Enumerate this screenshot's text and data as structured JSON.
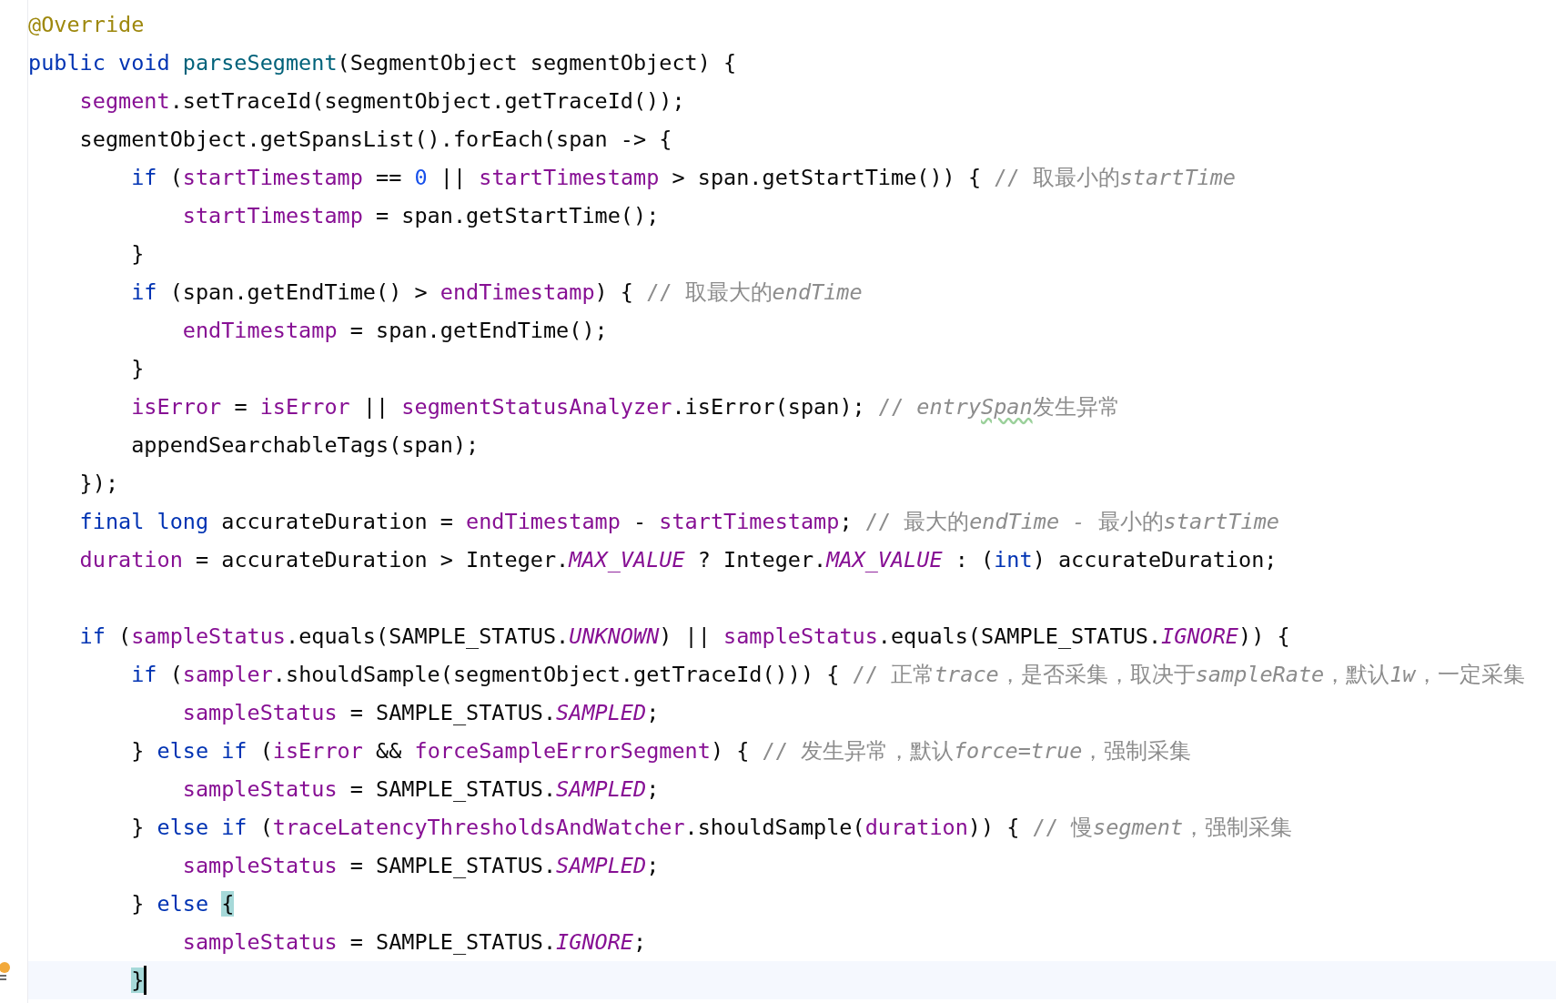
{
  "editor": {
    "lines": [
      {
        "kind": "code",
        "current": false,
        "tokens": [
          {
            "kind": "annotation",
            "text": "@Override"
          }
        ]
      },
      {
        "kind": "code",
        "current": false,
        "tokens": [
          {
            "kind": "keyword",
            "text": "public void "
          },
          {
            "kind": "method_decl",
            "text": "parseSegment"
          },
          {
            "kind": "plain",
            "text": "(SegmentObject segmentObject) {"
          }
        ]
      },
      {
        "kind": "code",
        "current": false,
        "tokens": [
          {
            "kind": "field",
            "text": "    segment"
          },
          {
            "kind": "plain",
            "text": ".setTraceId(segmentObject.getTraceId());"
          }
        ]
      },
      {
        "kind": "code",
        "current": false,
        "tokens": [
          {
            "kind": "plain",
            "text": "    segmentObject.getSpansList().forEach(span -> {"
          }
        ]
      },
      {
        "kind": "code",
        "current": false,
        "tokens": [
          {
            "kind": "keyword",
            "text": "        if "
          },
          {
            "kind": "plain",
            "text": "("
          },
          {
            "kind": "field",
            "text": "startTimestamp"
          },
          {
            "kind": "plain",
            "text": " == "
          },
          {
            "kind": "number",
            "text": "0"
          },
          {
            "kind": "plain",
            "text": " || "
          },
          {
            "kind": "field",
            "text": "startTimestamp"
          },
          {
            "kind": "plain",
            "text": " > span.getStartTime()) { "
          },
          {
            "kind": "comment",
            "text": "// 取最小的"
          },
          {
            "kind": "comment_italic",
            "text": "startTime"
          }
        ]
      },
      {
        "kind": "code",
        "current": false,
        "tokens": [
          {
            "kind": "field",
            "text": "            startTimestamp"
          },
          {
            "kind": "plain",
            "text": " = span.getStartTime();"
          }
        ]
      },
      {
        "kind": "code",
        "current": false,
        "tokens": [
          {
            "kind": "plain",
            "text": "        }"
          }
        ]
      },
      {
        "kind": "code",
        "current": false,
        "tokens": [
          {
            "kind": "keyword",
            "text": "        if "
          },
          {
            "kind": "plain",
            "text": "(span.getEndTime() > "
          },
          {
            "kind": "field",
            "text": "endTimestamp"
          },
          {
            "kind": "plain",
            "text": ") { "
          },
          {
            "kind": "comment",
            "text": "// 取最大的"
          },
          {
            "kind": "comment_italic",
            "text": "endTime"
          }
        ]
      },
      {
        "kind": "code",
        "current": false,
        "tokens": [
          {
            "kind": "field",
            "text": "            endTimestamp"
          },
          {
            "kind": "plain",
            "text": " = span.getEndTime();"
          }
        ]
      },
      {
        "kind": "code",
        "current": false,
        "tokens": [
          {
            "kind": "plain",
            "text": "        }"
          }
        ]
      },
      {
        "kind": "code",
        "current": false,
        "tokens": [
          {
            "kind": "field",
            "text": "        isError"
          },
          {
            "kind": "plain",
            "text": " = "
          },
          {
            "kind": "field",
            "text": "isError"
          },
          {
            "kind": "plain",
            "text": " || "
          },
          {
            "kind": "field",
            "text": "segmentStatusAnalyzer"
          },
          {
            "kind": "plain",
            "text": ".isError(span); "
          },
          {
            "kind": "comment",
            "text": "// "
          },
          {
            "kind": "comment_italic",
            "text": "entry"
          },
          {
            "kind": "typo",
            "text": "Span"
          },
          {
            "kind": "comment",
            "text": "发生异常"
          }
        ]
      },
      {
        "kind": "code",
        "current": false,
        "tokens": [
          {
            "kind": "plain",
            "text": "        appendSearchableTags(span);"
          }
        ]
      },
      {
        "kind": "code",
        "current": false,
        "tokens": [
          {
            "kind": "plain",
            "text": "    });"
          }
        ]
      },
      {
        "kind": "code",
        "current": false,
        "tokens": [
          {
            "kind": "keyword",
            "text": "    final long "
          },
          {
            "kind": "plain",
            "text": "accurateDuration = "
          },
          {
            "kind": "field",
            "text": "endTimestamp"
          },
          {
            "kind": "plain",
            "text": " - "
          },
          {
            "kind": "field",
            "text": "startTimestamp"
          },
          {
            "kind": "plain",
            "text": "; "
          },
          {
            "kind": "comment",
            "text": "// 最大的"
          },
          {
            "kind": "comment_italic",
            "text": "endTime - "
          },
          {
            "kind": "comment",
            "text": "最小的"
          },
          {
            "kind": "comment_italic",
            "text": "startTime"
          }
        ]
      },
      {
        "kind": "code",
        "current": false,
        "tokens": [
          {
            "kind": "field",
            "text": "    duration"
          },
          {
            "kind": "plain",
            "text": " = accurateDuration > Integer."
          },
          {
            "kind": "constant",
            "text": "MAX_VALUE"
          },
          {
            "kind": "plain",
            "text": " ? Integer."
          },
          {
            "kind": "constant",
            "text": "MAX_VALUE"
          },
          {
            "kind": "plain",
            "text": " : ("
          },
          {
            "kind": "keyword",
            "text": "int"
          },
          {
            "kind": "plain",
            "text": ") accurateDuration;"
          }
        ]
      },
      {
        "kind": "blank"
      },
      {
        "kind": "code",
        "current": false,
        "tokens": [
          {
            "kind": "keyword",
            "text": "    if "
          },
          {
            "kind": "plain",
            "text": "("
          },
          {
            "kind": "field",
            "text": "sampleStatus"
          },
          {
            "kind": "plain",
            "text": ".equals(SAMPLE_STATUS."
          },
          {
            "kind": "constant",
            "text": "UNKNOWN"
          },
          {
            "kind": "plain",
            "text": ") || "
          },
          {
            "kind": "field",
            "text": "sampleStatus"
          },
          {
            "kind": "plain",
            "text": ".equals(SAMPLE_STATUS."
          },
          {
            "kind": "constant",
            "text": "IGNORE"
          },
          {
            "kind": "plain",
            "text": ")) {"
          }
        ]
      },
      {
        "kind": "code",
        "current": false,
        "tokens": [
          {
            "kind": "keyword",
            "text": "        if "
          },
          {
            "kind": "plain",
            "text": "("
          },
          {
            "kind": "field",
            "text": "sampler"
          },
          {
            "kind": "plain",
            "text": ".shouldSample(segmentObject.getTraceId())) { "
          },
          {
            "kind": "comment",
            "text": "// 正常"
          },
          {
            "kind": "comment_italic",
            "text": "trace"
          },
          {
            "kind": "comment",
            "text": "，是否采集，取决于"
          },
          {
            "kind": "comment_italic",
            "text": "sampleRate"
          },
          {
            "kind": "comment",
            "text": "，默认"
          },
          {
            "kind": "comment_italic",
            "text": "1w"
          },
          {
            "kind": "comment",
            "text": "，一定采集"
          }
        ]
      },
      {
        "kind": "code",
        "current": false,
        "tokens": [
          {
            "kind": "field",
            "text": "            sampleStatus"
          },
          {
            "kind": "plain",
            "text": " = SAMPLE_STATUS."
          },
          {
            "kind": "constant",
            "text": "SAMPLED"
          },
          {
            "kind": "plain",
            "text": ";"
          }
        ]
      },
      {
        "kind": "code",
        "current": false,
        "tokens": [
          {
            "kind": "plain",
            "text": "        } "
          },
          {
            "kind": "keyword",
            "text": "else if "
          },
          {
            "kind": "plain",
            "text": "("
          },
          {
            "kind": "field",
            "text": "isError"
          },
          {
            "kind": "plain",
            "text": " && "
          },
          {
            "kind": "field",
            "text": "forceSampleErrorSegment"
          },
          {
            "kind": "plain",
            "text": ") { "
          },
          {
            "kind": "comment",
            "text": "// 发生异常，默认"
          },
          {
            "kind": "comment_italic",
            "text": "force=true"
          },
          {
            "kind": "comment",
            "text": "，强制采集"
          }
        ]
      },
      {
        "kind": "code",
        "current": false,
        "tokens": [
          {
            "kind": "field",
            "text": "            sampleStatus"
          },
          {
            "kind": "plain",
            "text": " = SAMPLE_STATUS."
          },
          {
            "kind": "constant",
            "text": "SAMPLED"
          },
          {
            "kind": "plain",
            "text": ";"
          }
        ]
      },
      {
        "kind": "code",
        "current": false,
        "tokens": [
          {
            "kind": "plain",
            "text": "        } "
          },
          {
            "kind": "keyword",
            "text": "else if "
          },
          {
            "kind": "plain",
            "text": "("
          },
          {
            "kind": "field",
            "text": "traceLatencyThresholdsAndWatcher"
          },
          {
            "kind": "plain",
            "text": ".shouldSample("
          },
          {
            "kind": "field",
            "text": "duration"
          },
          {
            "kind": "plain",
            "text": ")) { "
          },
          {
            "kind": "comment",
            "text": "// 慢"
          },
          {
            "kind": "comment_italic",
            "text": "segment"
          },
          {
            "kind": "comment",
            "text": "，强制采集"
          }
        ]
      },
      {
        "kind": "code",
        "current": false,
        "tokens": [
          {
            "kind": "field",
            "text": "            sampleStatus"
          },
          {
            "kind": "plain",
            "text": " = SAMPLE_STATUS."
          },
          {
            "kind": "constant",
            "text": "SAMPLED"
          },
          {
            "kind": "plain",
            "text": ";"
          }
        ]
      },
      {
        "kind": "code",
        "current": false,
        "tokens": [
          {
            "kind": "plain",
            "text": "        } "
          },
          {
            "kind": "keyword",
            "text": "else "
          },
          {
            "kind": "brace_match",
            "text": "{"
          }
        ]
      },
      {
        "kind": "code",
        "current": false,
        "tokens": [
          {
            "kind": "field",
            "text": "            sampleStatus"
          },
          {
            "kind": "plain",
            "text": " = SAMPLE_STATUS."
          },
          {
            "kind": "constant",
            "text": "IGNORE"
          },
          {
            "kind": "plain",
            "text": ";"
          }
        ]
      },
      {
        "kind": "code",
        "current": true,
        "tokens": [
          {
            "kind": "brace_match",
            "text": "        }"
          }
        ]
      }
    ]
  }
}
